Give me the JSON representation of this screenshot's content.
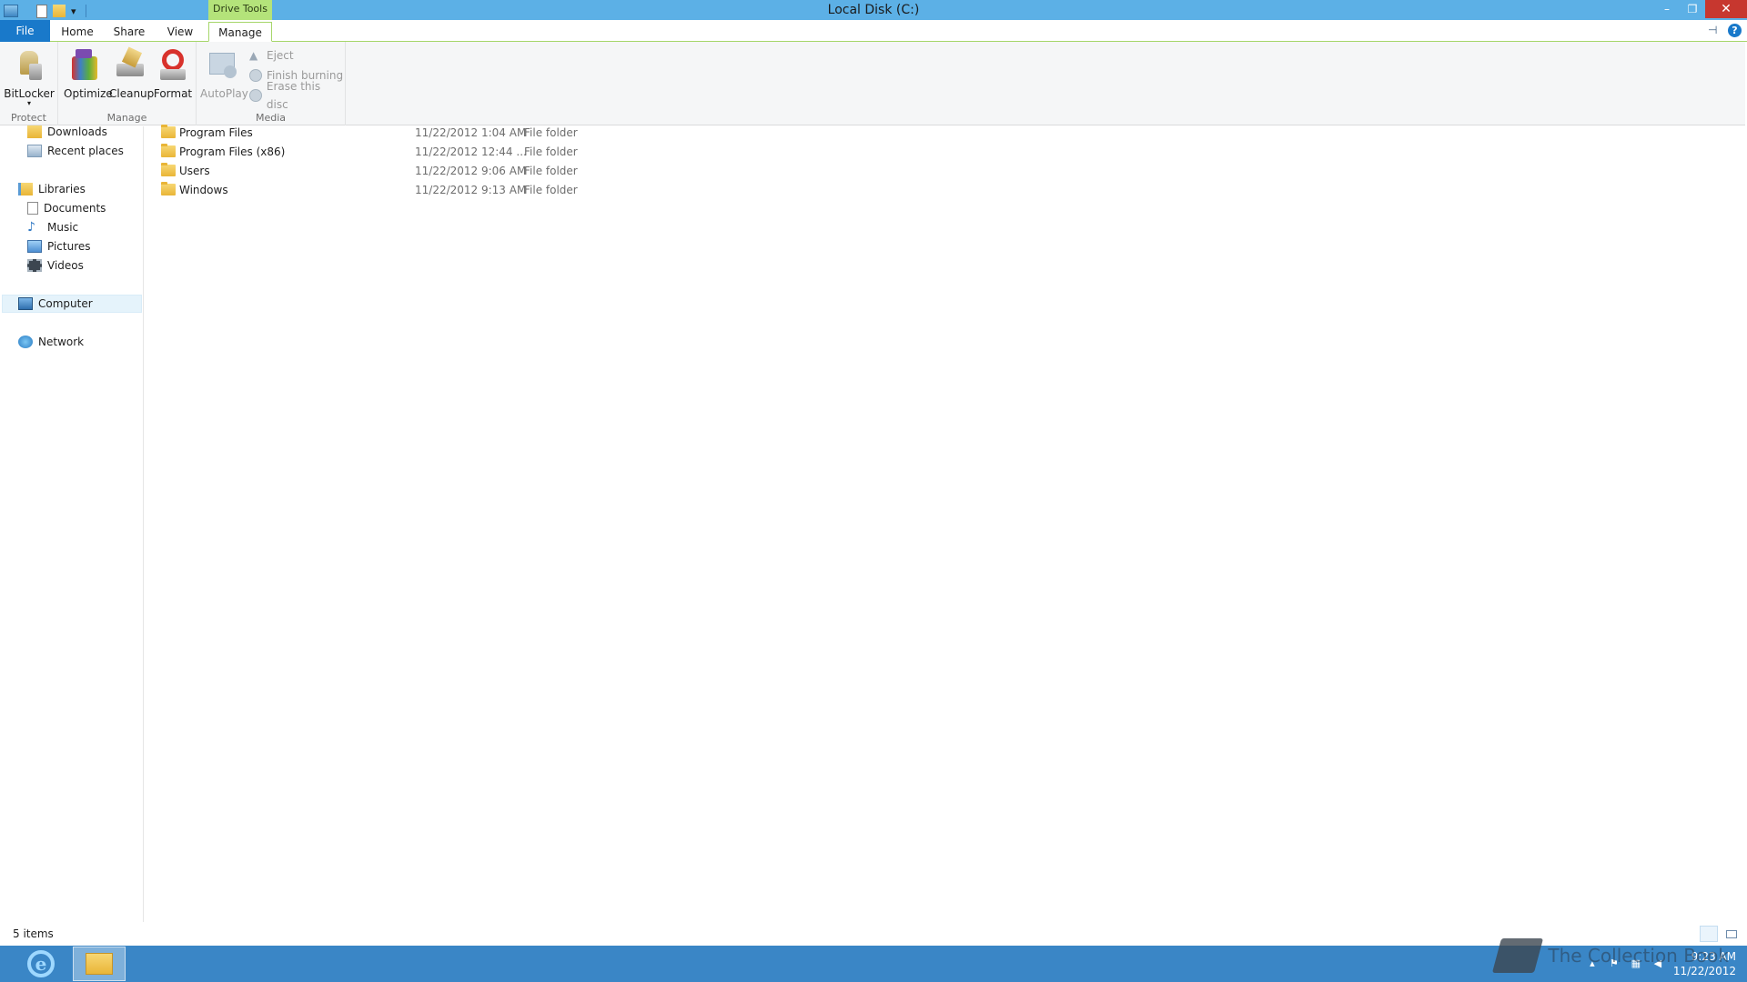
{
  "window": {
    "title": "Local Disk (C:)",
    "context_tab": "Drive Tools",
    "controls": {
      "minimize": "–",
      "restore": "❐",
      "close": "✕"
    }
  },
  "qat": {
    "icons": [
      "properties-icon",
      "new-folder-icon",
      "customize-dropdown-icon"
    ],
    "dropdown_glyph": "▾"
  },
  "tabs": [
    {
      "label": "File"
    },
    {
      "label": "Home"
    },
    {
      "label": "Share"
    },
    {
      "label": "View"
    },
    {
      "label": "Manage"
    }
  ],
  "ribbon": {
    "groups": {
      "protect": "Protect",
      "manage": "Manage",
      "media": "Media"
    },
    "buttons": {
      "bitlocker": "BitLocker",
      "optimize": "Optimize",
      "cleanup": "Cleanup",
      "format": "Format",
      "autoplay": "AutoPlay",
      "eject": "Eject",
      "finish_burning": "Finish burning",
      "erase_disc": "Erase this disc"
    },
    "help_glyph": "?",
    "pin_glyph": "⊣"
  },
  "nav": {
    "downloads": "Downloads",
    "recent_places": "Recent places",
    "libraries": "Libraries",
    "documents": "Documents",
    "music": "Music",
    "pictures": "Pictures",
    "videos": "Videos",
    "computer": "Computer",
    "network": "Network"
  },
  "files": [
    {
      "name": "Program Files",
      "date": "11/22/2012 1:04 AM",
      "type": "File folder"
    },
    {
      "name": "Program Files (x86)",
      "date": "11/22/2012 12:44 ...",
      "type": "File folder"
    },
    {
      "name": "Users",
      "date": "11/22/2012 9:06 AM",
      "type": "File folder"
    },
    {
      "name": "Windows",
      "date": "11/22/2012 9:13 AM",
      "type": "File folder"
    }
  ],
  "status": {
    "item_count": "5 items"
  },
  "taskbar": {
    "ie_glyph": "e",
    "clock_time": "9:23 AM",
    "clock_date": "11/22/2012"
  },
  "watermark": "The Collection Book",
  "colors": {
    "titlebar": "#5cb0e6",
    "file_tab": "#1979ca",
    "context_tab": "#b4e37a",
    "taskbar": "#3a86c6",
    "close_button": "#c7372f"
  }
}
